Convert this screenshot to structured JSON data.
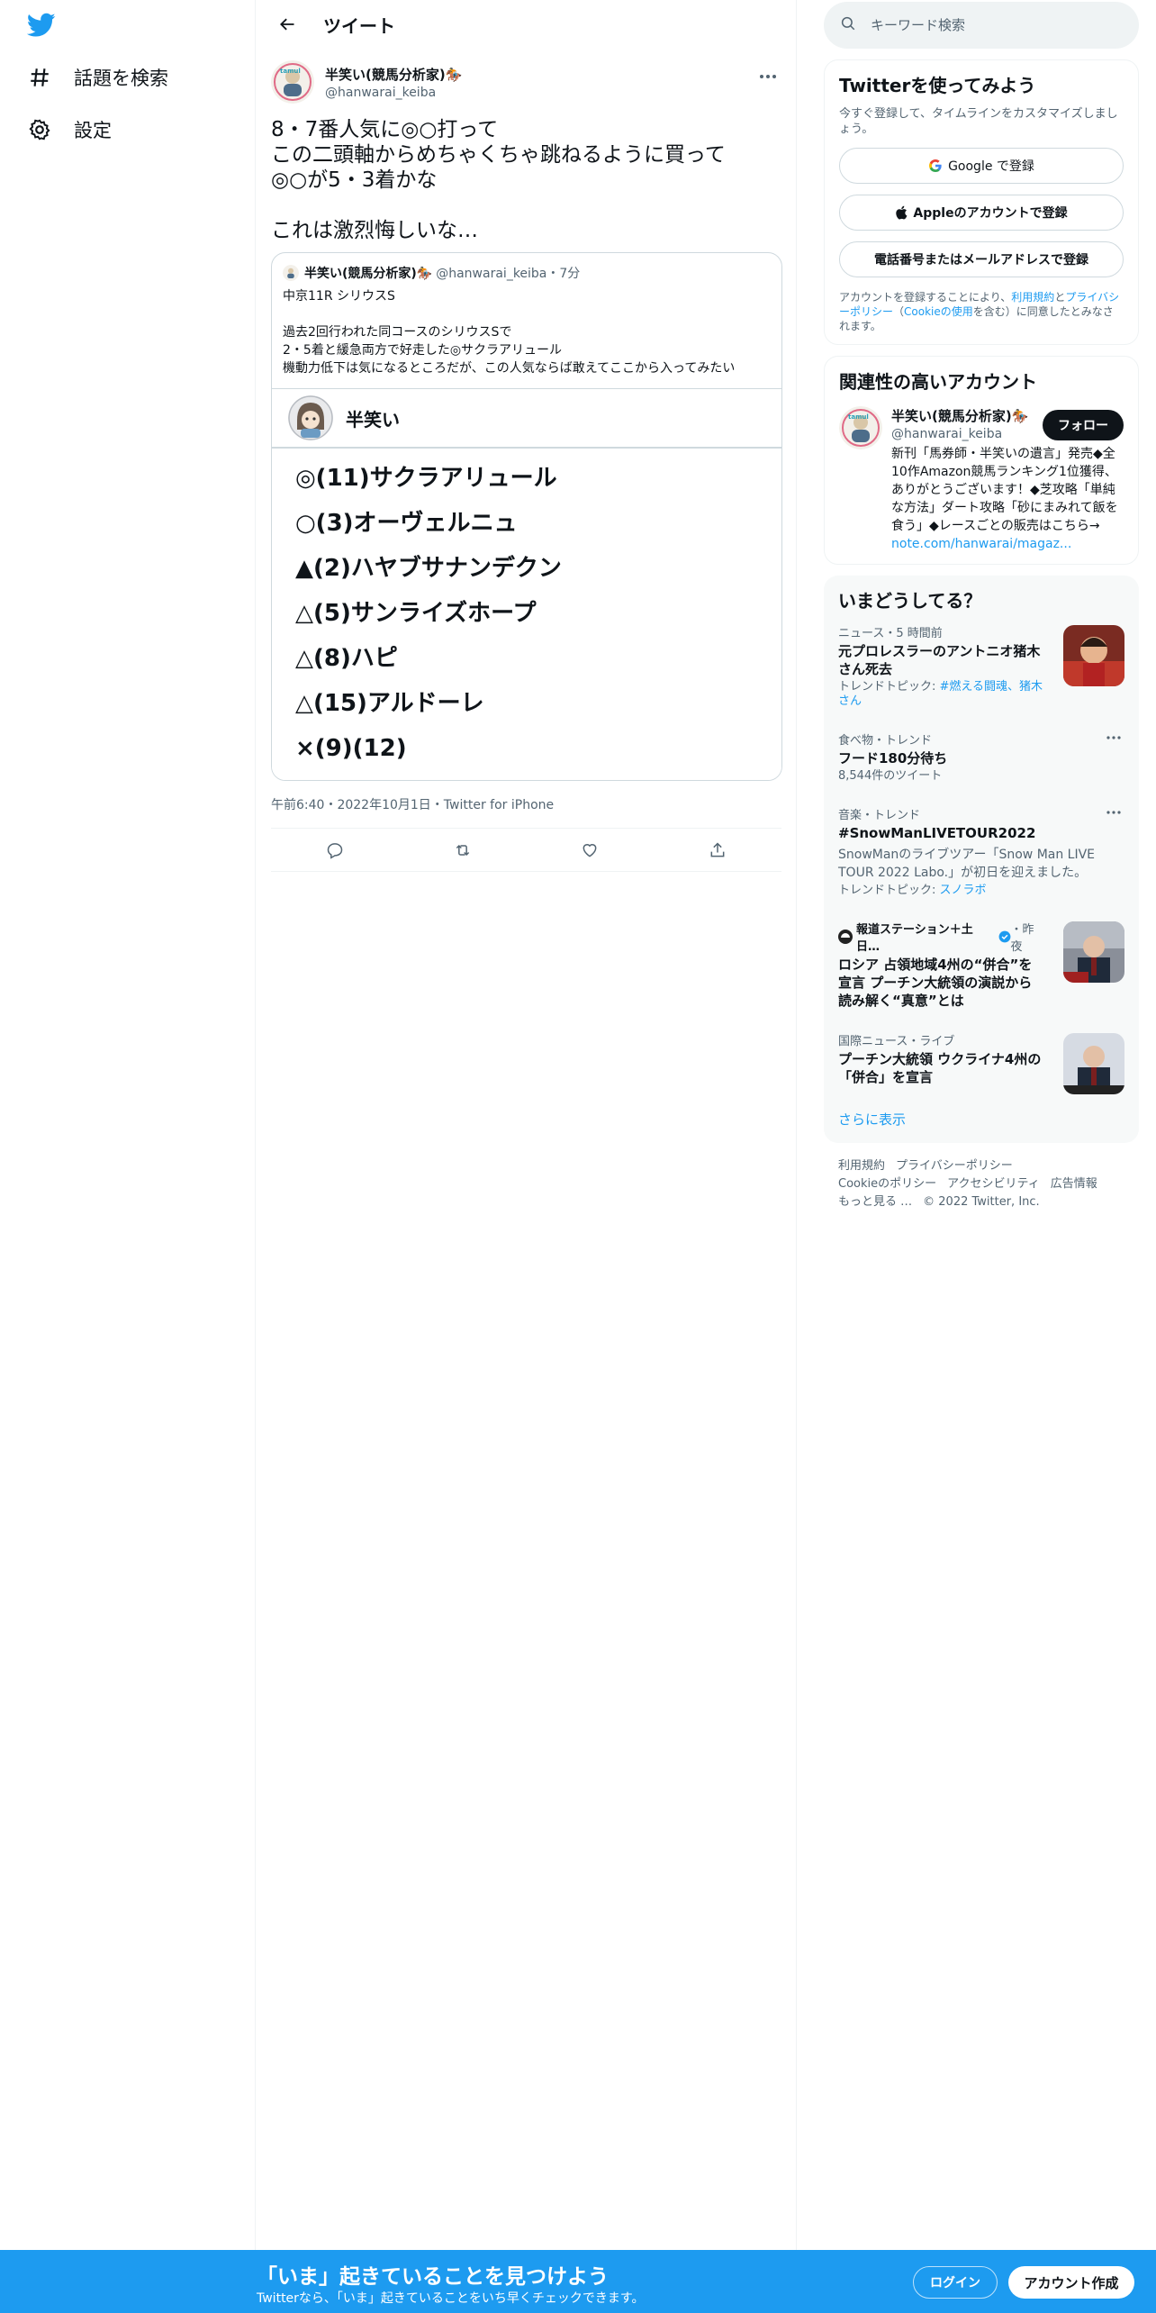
{
  "nav": {
    "explore_label": "話題を検索",
    "settings_label": "設定"
  },
  "header": {
    "title": "ツイート"
  },
  "tweet": {
    "author_name": "半笑い(競馬分析家)🏇",
    "author_handle": "@hanwarai_keiba",
    "text": "8・7番人気に◎○打って\nこの二頭軸からめちゃくちゃ跳ねるように買って\n◎○が5・3着かな\n\nこれは激烈悔しいな…",
    "meta": "午前6:40・2022年10月1日・Twitter for iPhone",
    "quote": {
      "name": "半笑い(競馬分析家)🏇",
      "handle_time": "@hanwarai_keiba・7分",
      "text": "中京11R シリウスS\n\n過去2回行われた同コースのシリウスSで\n2・5着と緩急両方で好走した◎サクラアリュール\n機動力低下は気になるところだが、この人気ならば敢えてここから入ってみたい",
      "card_name": "半笑い",
      "picks": [
        "◎(11)サクラアリュール",
        "○(3)オーヴェルニュ",
        "▲(2)ハヤブサナンデクン",
        "△(5)サンライズホープ",
        "△(8)ハピ",
        "△(15)アルドーレ",
        "×(9)(12)"
      ]
    }
  },
  "search": {
    "placeholder": "キーワード検索"
  },
  "signup_panel": {
    "title": "Twitterを使ってみよう",
    "subtitle": "今すぐ登録して、タイムラインをカスタマイズしましょう。",
    "google_label": "Google で登録",
    "apple_label": "Appleのアカウントで登録",
    "phone_label": "電話番号またはメールアドレスで登録",
    "legal_prefix": "アカウントを登録することにより、",
    "legal_terms": "利用規約",
    "legal_and": "と",
    "legal_privacy": "プライバシーポリシー",
    "legal_paren_open": "（",
    "legal_cookie": "Cookieの使用",
    "legal_suffix": "を含む）に同意したとみなされます。"
  },
  "related": {
    "title": "関連性の高いアカウント",
    "name": "半笑い(競馬分析家)🏇",
    "handle": "@hanwarai_keiba",
    "follow_label": "フォロー",
    "bio": "新刊「馬券師・半笑いの遺言」発売◆全10作Amazon競馬ランキング1位獲得、ありがとうございます！◆芝攻略「単純な方法」ダート攻略「砂にまみれて飯を食う」◆レースごとの販売はこちら→ ",
    "bio_link": "note.com/hanwarai/magaz..."
  },
  "trends": {
    "title": "いまどうしてる？",
    "items": [
      {
        "category": "ニュース・5 時間前",
        "title": "元プロレスラーのアントニオ猪木さん死去",
        "topics_label": "トレンドトピック: ",
        "topics": "#燃える闘魂、猪木さん"
      },
      {
        "category": "食べ物・トレンド",
        "title": "フード180分待ち",
        "count": "8,544件のツイート"
      },
      {
        "category": "音楽・トレンド",
        "title": "#SnowManLIVETOUR2022",
        "desc": "SnowManのライブツアー「Snow Man LIVE TOUR 2022 Labo.」が初日を迎えました。",
        "topics_label": "トレンドトピック: ",
        "topics": "スノラボ"
      },
      {
        "category": "報道ステーション＋土日…",
        "time": "・昨夜",
        "title": "ロシア 占領地域4州の“併合”を宣言 プーチン大統領の演説から読み解く“真意”とは"
      },
      {
        "category": "国際ニュース・ライブ",
        "title": "プーチン大統領 ウクライナ4州の「併合」を宣言"
      }
    ],
    "show_more": "さらに表示"
  },
  "footer": {
    "links": [
      "利用規約",
      "プライバシーポリシー",
      "Cookieのポリシー",
      "アクセシビリティ",
      "広告情報",
      "もっと見る …"
    ],
    "copyright": "© 2022 Twitter, Inc."
  },
  "bottom_bar": {
    "title": "「いま」起きていることを見つけよう",
    "subtitle": "Twitterなら、「いま」起きていることをいち早くチェックできます。",
    "login_label": "ログイン",
    "signup_label": "アカウント作成"
  },
  "colors": {
    "brand": "#1d9bf0",
    "text": "#0f1419",
    "muted": "#536471",
    "border": "#eff3f4"
  }
}
